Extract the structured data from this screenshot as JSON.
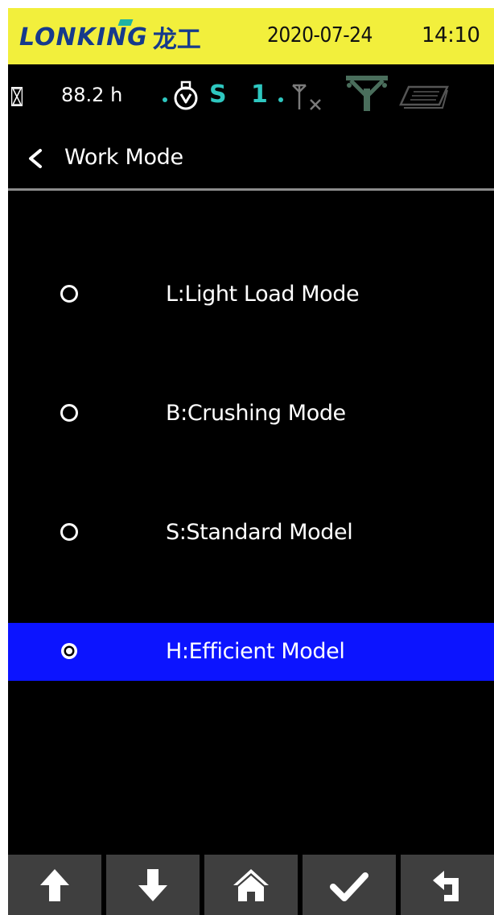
{
  "header": {
    "brand_name": "LONKING",
    "brand_cn": "龙工",
    "date": "2020-07-24",
    "time": "14:10",
    "background_color": "#f2ef3c",
    "brand_color": "#163a8c"
  },
  "status_bar": {
    "hours": "88.2 h",
    "gear": "S 1",
    "icons": [
      "hourglass-icon",
      "engine-icon",
      "antenna-off-icon",
      "signal-tower-icon",
      "manual-book-icon"
    ],
    "accent_color": "#2ec7c0"
  },
  "page": {
    "title": "Work Mode",
    "back_icon": "chevron-left-icon"
  },
  "options": [
    {
      "label": "L:Light Load Mode",
      "selected": false
    },
    {
      "label": "B:Crushing Mode",
      "selected": false
    },
    {
      "label": "S:Standard Model",
      "selected": false
    },
    {
      "label": "H:Efficient Model",
      "selected": true
    }
  ],
  "selection_color": "#0c14ff",
  "toolbar": {
    "buttons": [
      {
        "icon": "arrow-up-icon"
      },
      {
        "icon": "arrow-down-icon"
      },
      {
        "icon": "home-icon"
      },
      {
        "icon": "checkmark-icon"
      },
      {
        "icon": "return-icon"
      }
    ]
  }
}
